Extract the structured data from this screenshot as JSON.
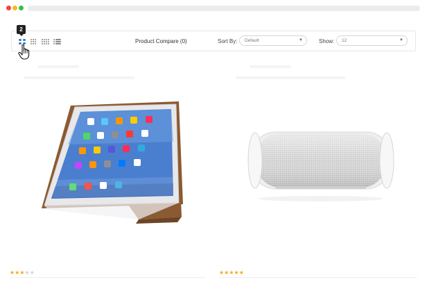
{
  "browser": {
    "window_controls": [
      "close",
      "minimize",
      "maximize"
    ]
  },
  "toolbar": {
    "callout_number": "2",
    "view_modes": [
      "grid-2-icon",
      "grid-3-icon",
      "grid-4-icon",
      "list-icon"
    ],
    "active_view": "grid-2-icon",
    "compare_label": "Product Compare (0)",
    "sort_label": "Sort By:",
    "sort_value": "Default",
    "show_label": "Show:",
    "show_value": "12",
    "accent_color": "#2e78b7"
  },
  "products": [
    {
      "image": "ipad-smart-case",
      "rating": 3,
      "rating_max": 5,
      "stars_on": "★★★",
      "stars_off": "★★"
    },
    {
      "image": "bluetooth-speaker",
      "rating": 5,
      "rating_max": 5,
      "stars_on": "★★★★★",
      "stars_off": ""
    }
  ],
  "colors": {
    "star": "#f5a623",
    "star_empty": "#d3d3d3"
  }
}
